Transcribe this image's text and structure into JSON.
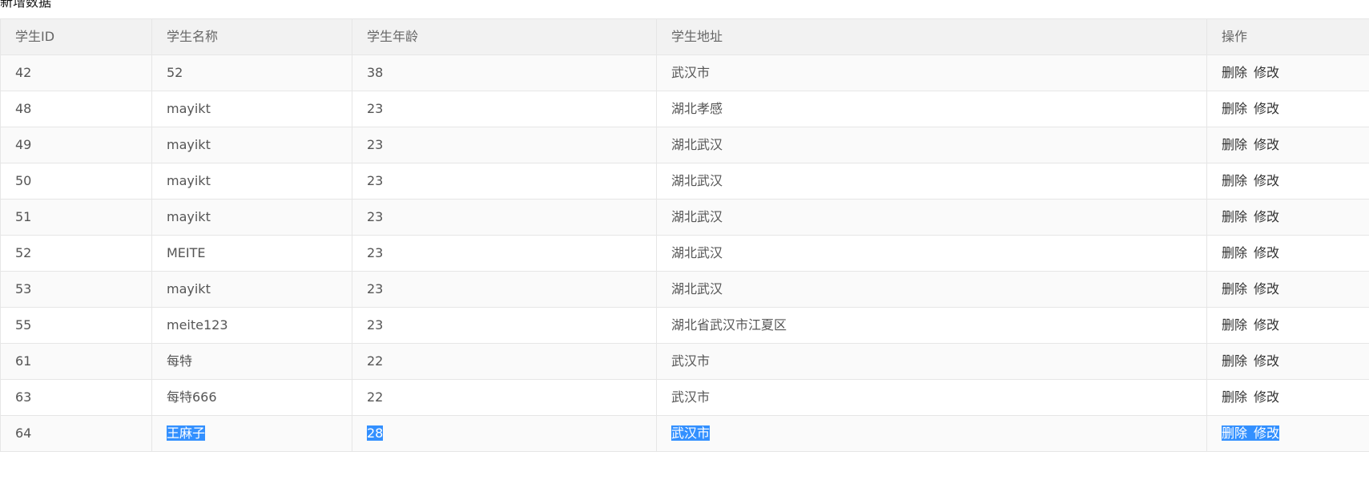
{
  "add_link": "新增数据",
  "columns": [
    "学生ID",
    "学生名称",
    "学生年龄",
    "学生地址",
    "操作"
  ],
  "actions": {
    "delete": "删除",
    "edit": "修改"
  },
  "rows": [
    {
      "id": "42",
      "name": "52",
      "age": "38",
      "address": "武汉市"
    },
    {
      "id": "48",
      "name": "mayikt",
      "age": "23",
      "address": "湖北孝感"
    },
    {
      "id": "49",
      "name": "mayikt",
      "age": "23",
      "address": "湖北武汉"
    },
    {
      "id": "50",
      "name": "mayikt",
      "age": "23",
      "address": "湖北武汉"
    },
    {
      "id": "51",
      "name": "mayikt",
      "age": "23",
      "address": "湖北武汉"
    },
    {
      "id": "52",
      "name": "MEITE",
      "age": "23",
      "address": "湖北武汉"
    },
    {
      "id": "53",
      "name": "mayikt",
      "age": "23",
      "address": "湖北武汉"
    },
    {
      "id": "55",
      "name": "meite123",
      "age": "23",
      "address": "湖北省武汉市江夏区"
    },
    {
      "id": "61",
      "name": "每特",
      "age": "22",
      "address": "武汉市"
    },
    {
      "id": "63",
      "name": "每特666",
      "age": "22",
      "address": "武汉市"
    },
    {
      "id": "64",
      "name": "王麻子",
      "age": "28",
      "address": "武汉市"
    }
  ],
  "colors": {
    "header_bg": "#f2f2f2",
    "border": "#e6e6e6",
    "selection": "#3390ff"
  }
}
